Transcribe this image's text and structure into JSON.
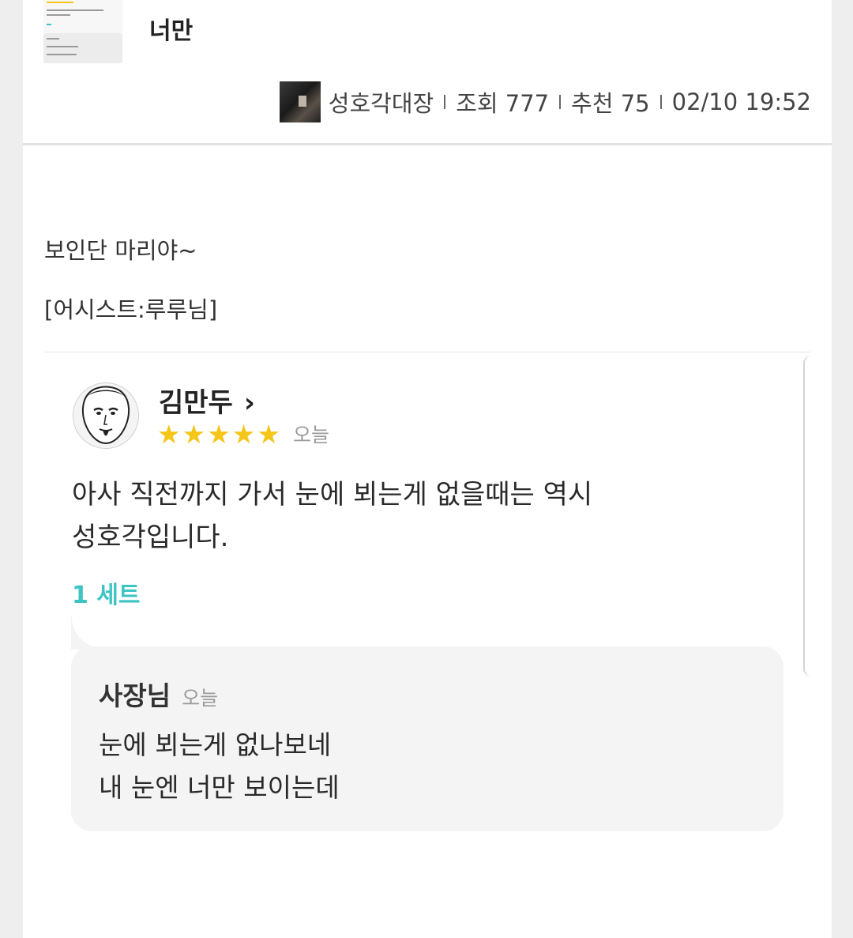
{
  "post": {
    "title": "너만",
    "author": "성호각대장",
    "views": "조회 777",
    "recommend": "추천 75",
    "datetime": "02/10 19:52"
  },
  "body": {
    "line1": "보인단 마리야~",
    "line2": "[어시스트:루루님]"
  },
  "review": {
    "reviewer": "김만두",
    "chevron": "›",
    "rating": 5,
    "star_glyph": "★",
    "star_color": "#f5c518",
    "date": "오늘",
    "text_line1": "아사 직전까지 가서 눈에 뵈는게 없을때는 역시",
    "text_line2": "성호각입니다.",
    "option": "1 세트",
    "option_color": "#3ec4c4"
  },
  "reply": {
    "author": "사장님",
    "date": "오늘",
    "line1": "눈에 뵈는게 없나보네",
    "line2": "내 눈엔 너만 보이는데"
  }
}
